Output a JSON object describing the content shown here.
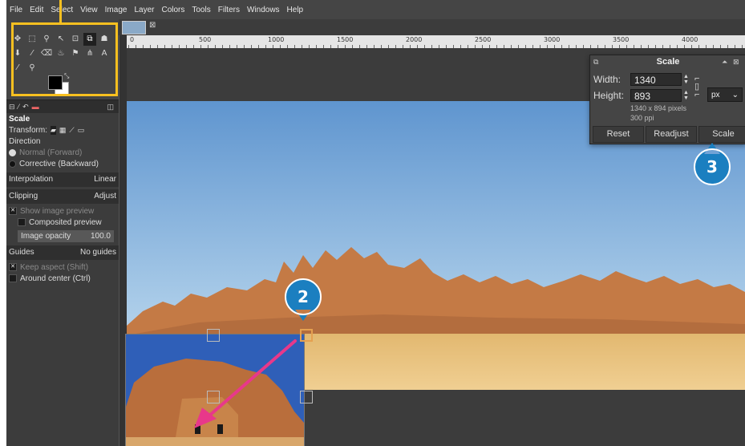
{
  "menubar": {
    "items": [
      "File",
      "Edit",
      "Select",
      "View",
      "Image",
      "Layer",
      "Colors",
      "Tools",
      "Filters",
      "Windows",
      "Help"
    ]
  },
  "toolbox": {
    "tools": [
      {
        "glyph": "✥",
        "icon": "move-icon",
        "selected": false
      },
      {
        "glyph": "⬚",
        "icon": "rect-select-icon",
        "selected": false
      },
      {
        "glyph": "⚲",
        "icon": "free-select-icon",
        "selected": false
      },
      {
        "glyph": "↖",
        "icon": "fuzzy-select-icon",
        "selected": false
      },
      {
        "glyph": "⊡",
        "icon": "crop-icon",
        "selected": false
      },
      {
        "glyph": "⧉",
        "icon": "scale-tool-icon",
        "selected": true
      },
      {
        "glyph": "☗",
        "icon": "warp-icon",
        "selected": false
      },
      {
        "glyph": "⬇",
        "icon": "bucket-fill-icon",
        "selected": false
      },
      {
        "glyph": "⁄",
        "icon": "paintbrush-icon",
        "selected": false
      },
      {
        "glyph": "⌫",
        "icon": "eraser-icon",
        "selected": false
      },
      {
        "glyph": "♨",
        "icon": "clone-icon",
        "selected": false
      },
      {
        "glyph": "⚑",
        "icon": "smudge-icon",
        "selected": false
      },
      {
        "glyph": "⋔",
        "icon": "paths-icon",
        "selected": false
      },
      {
        "glyph": "A",
        "icon": "text-tool-icon",
        "selected": false
      },
      {
        "glyph": "⁄",
        "icon": "color-picker-icon",
        "selected": false
      },
      {
        "glyph": "⚲",
        "icon": "zoom-icon",
        "selected": false
      }
    ],
    "highlight_color": "#f8c020"
  },
  "image_tab": {
    "close_glyph": "⊠"
  },
  "ruler": {
    "labels": [
      "0",
      "500",
      "1000",
      "1500",
      "2000",
      "2500",
      "3000",
      "3500",
      "4000"
    ]
  },
  "tool_options": {
    "title": "Scale",
    "transform_label": "Transform:",
    "direction_label": "Direction",
    "direction_options": [
      "Normal (Forward)",
      "Corrective (Backward)"
    ],
    "interpolation_label": "Interpolation",
    "interpolation_value": "Linear",
    "clipping_label": "Clipping",
    "clipping_value": "Adjust",
    "show_preview_label": "Show image preview",
    "composited_preview_label": "Composited preview",
    "opacity_label": "Image opacity",
    "opacity_value": "100.0",
    "guides_label": "Guides",
    "guides_value": "No guides",
    "keep_aspect_label": "Keep aspect (Shift)",
    "around_center_label": "Around center (Ctrl)"
  },
  "scale_dialog": {
    "title": "Scale",
    "width_label": "Width:",
    "width_value": "1340",
    "height_label": "Height:",
    "height_value": "893",
    "unit": "px",
    "pixel_info": "1340 x 894 pixels",
    "ppi_info": "300 ppi",
    "buttons": [
      "Reset",
      "Readjust",
      "Scale"
    ]
  },
  "markers": [
    {
      "label": "2",
      "color": "#1b7fc0"
    },
    {
      "label": "3",
      "color": "#1b7fc0"
    }
  ],
  "arrow_color": "#e8388a"
}
